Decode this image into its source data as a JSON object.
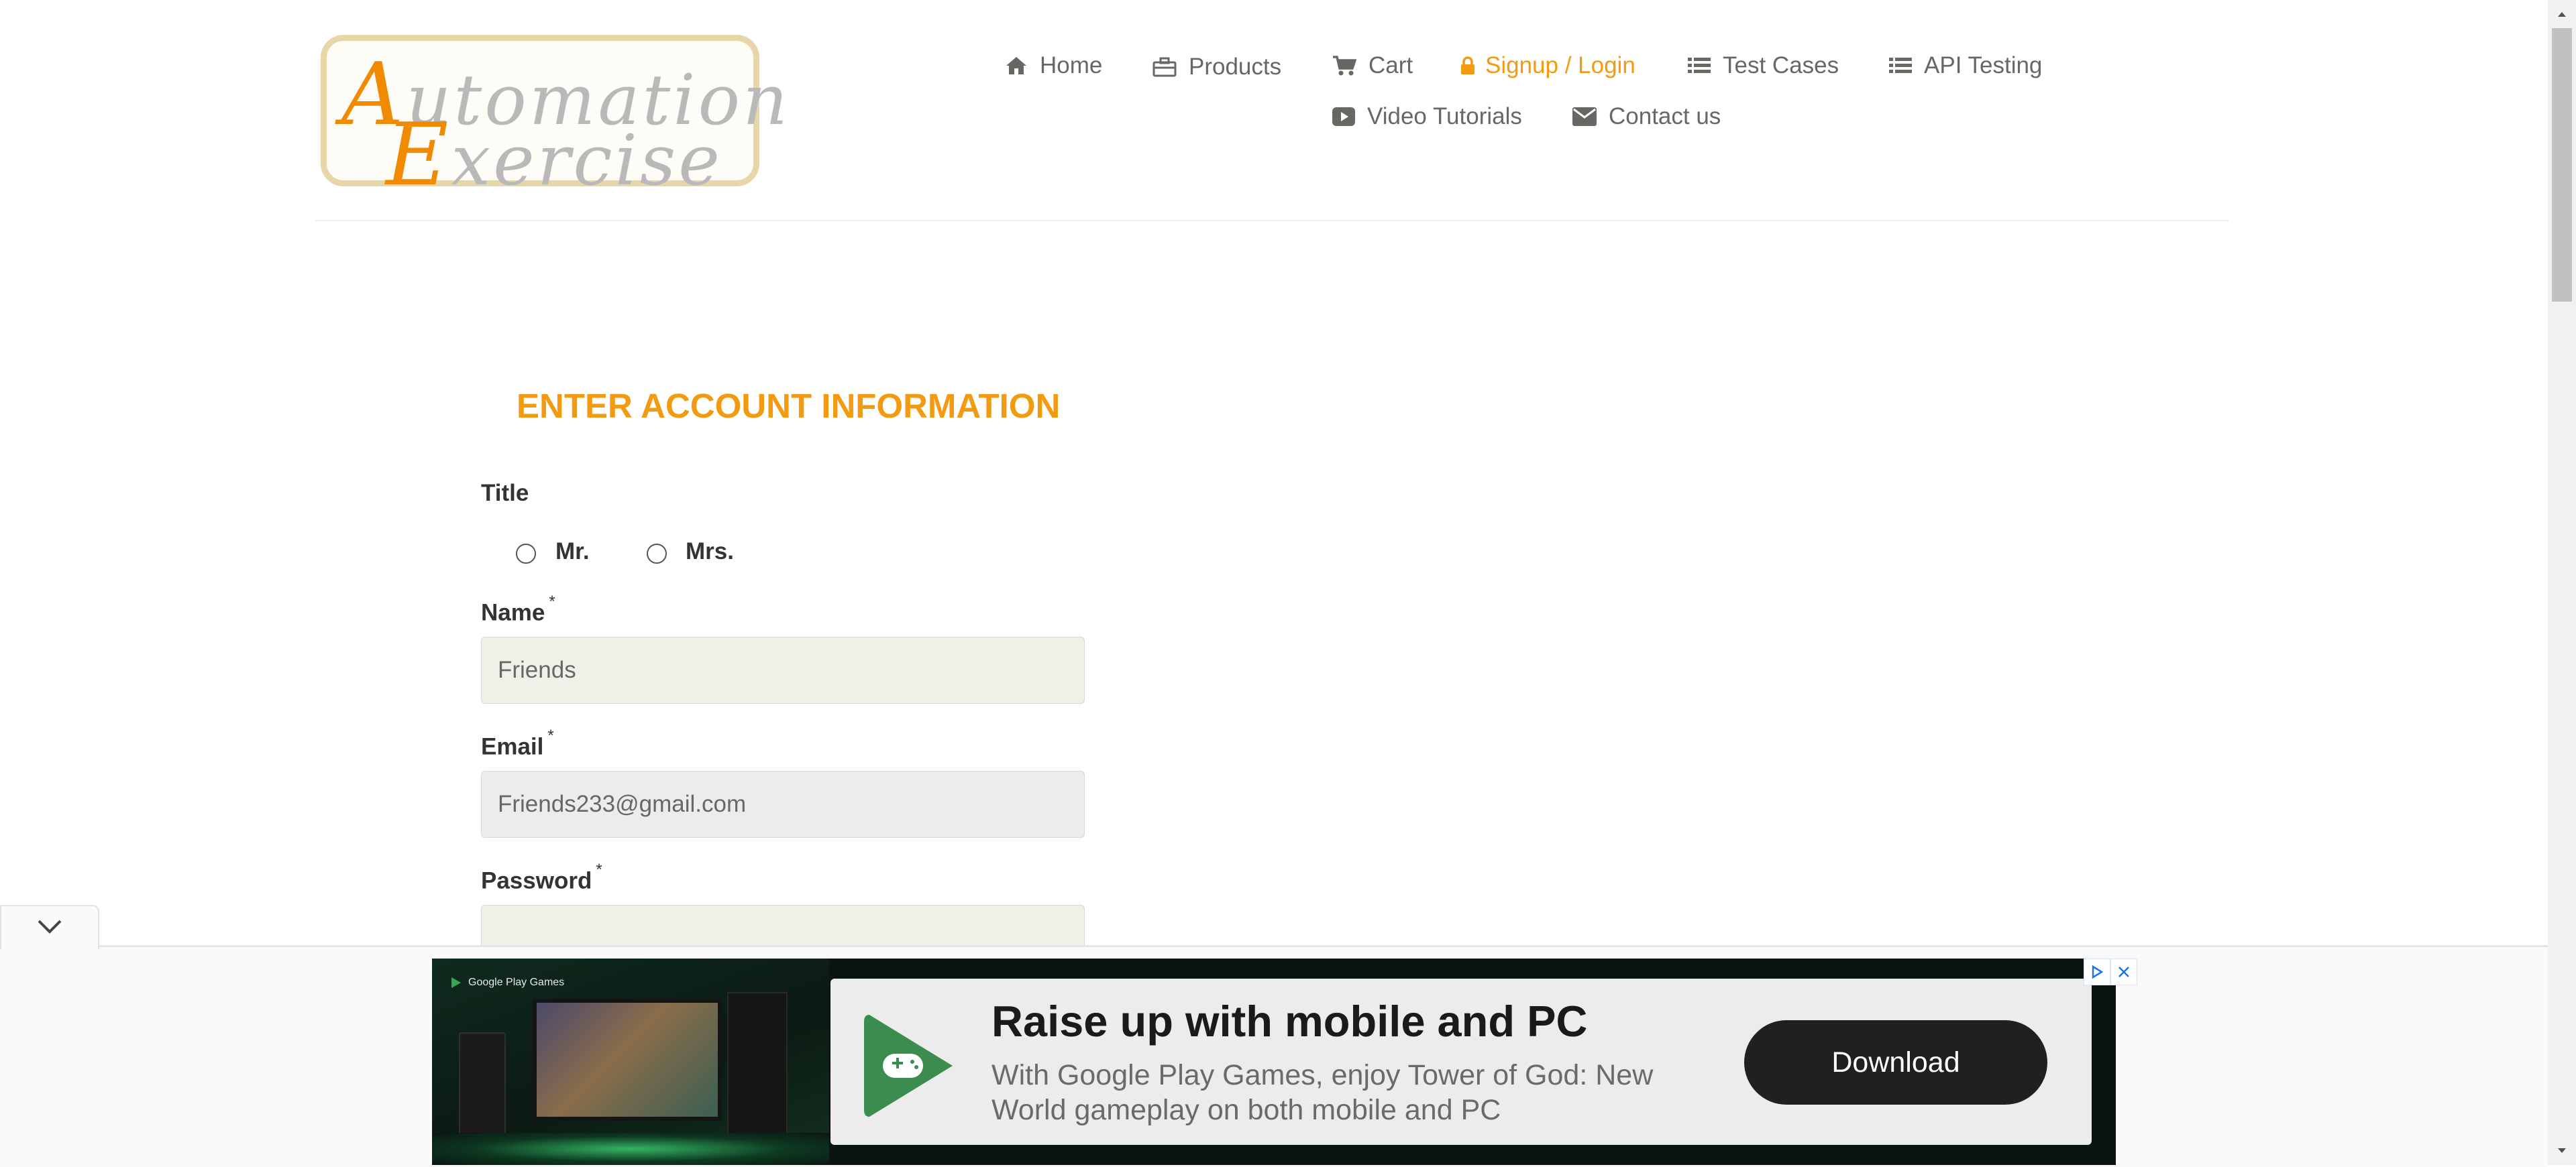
{
  "logo": {
    "line1_cap": "A",
    "line1_rest": "utomation",
    "line2_cap": "E",
    "line2_rest": "xercise"
  },
  "nav": {
    "home": "Home",
    "products": "Products",
    "cart": "Cart",
    "signup_login": "Signup / Login",
    "test_cases": "Test Cases",
    "api_testing": "API Testing",
    "video_tutorials": "Video Tutorials",
    "contact_us": "Contact us"
  },
  "colors": {
    "accent": "#f29b11",
    "nav_text": "#696763",
    "input_bg": "#f0f0e9",
    "ad_button": "#202020"
  },
  "form": {
    "heading": "ENTER ACCOUNT INFORMATION",
    "title_label": "Title",
    "title_options": [
      "Mr.",
      "Mrs."
    ],
    "name_label": "Name",
    "name_value": "Friends",
    "email_label": "Email",
    "email_value": "Friends233@gmail.com",
    "password_label": "Password",
    "required_mark": "*"
  },
  "ad": {
    "brand_badge": "Google Play Games",
    "headline": "Raise up with mobile and PC",
    "body": "With Google Play Games, enjoy Tower of God: New World gameplay on both mobile and PC",
    "cta": "Download"
  },
  "icons": [
    "home-icon",
    "products-icon",
    "cart-icon",
    "lock-icon",
    "list-icon",
    "video-icon",
    "envelope-icon",
    "chevron-down-icon",
    "adchoices-icon",
    "close-icon",
    "google-play-games-icon"
  ]
}
